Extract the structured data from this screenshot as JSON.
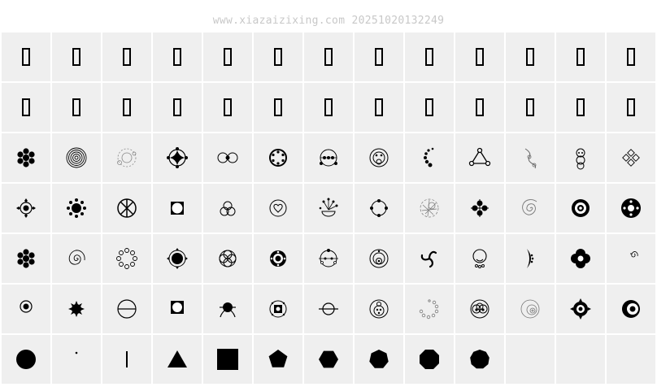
{
  "header": {
    "watermark": "www.xiazaizixing.com 20251020132249"
  },
  "glyph_grid": {
    "rows": 7,
    "columns": 13,
    "cells": [
      "notdef-icon",
      "notdef-icon",
      "notdef-icon",
      "notdef-icon",
      "notdef-icon",
      "notdef-icon",
      "notdef-icon",
      "notdef-icon",
      "notdef-icon",
      "notdef-icon",
      "notdef-icon",
      "notdef-icon",
      "notdef-icon",
      "notdef-icon",
      "notdef-icon",
      "notdef-icon",
      "notdef-icon",
      "notdef-icon",
      "notdef-icon",
      "notdef-icon",
      "notdef-icon",
      "notdef-icon",
      "notdef-icon",
      "notdef-icon",
      "notdef-icon",
      "notdef-icon",
      "flower-dots-icon",
      "concentric-rings-icon",
      "dotted-ring-icon",
      "diamond-star-icon",
      "linked-rings-icon",
      "ring-of-dots-icon",
      "orbit-dots-icon",
      "nested-circles-icon",
      "dot-arc-icon",
      "triangle-nodes-icon",
      "wave-curve-icon",
      "stacked-circles-icon",
      "diamond-cluster-icon",
      "target-diamond-icon",
      "spiky-sun-icon",
      "wheel-spokes-icon",
      "square-corners-icon",
      "trefoil-icon",
      "heart-ring-icon",
      "branch-dots-icon",
      "circle-dots-icon",
      "tangle-icon",
      "dot-cross-icon",
      "spiral-icon",
      "gear-circle-icon",
      "donut-dots-icon",
      "flower-dots-icon",
      "spiral-ring-icon",
      "scalloped-ring-icon",
      "ring-diamond-icon",
      "quad-petal-icon",
      "dot-ring-icon",
      "circle-line-dots-icon",
      "ornate-circle-icon",
      "triskele-icon",
      "pendant-circle-icon",
      "crescent-dots-icon",
      "quatrefoil-icon",
      "small-spiral-icon",
      "target-dot-icon",
      "small-sun-icon",
      "theta-circle-icon",
      "square-circle-icon",
      "bug-circle-icon",
      "boxed-circle-icon",
      "crossed-circle-icon",
      "face-circle-icon",
      "dotted-arc-icon",
      "triple-circles-icon",
      "spiral-circles-icon",
      "ornate-diamond-icon",
      "crescent-eye-icon",
      "disc-icon",
      "dot-icon",
      "vertical-bar-icon",
      "triangle-icon",
      "square-icon",
      "pentagon-icon",
      "hexagon-icon",
      "heptagon-icon",
      "octagon-icon",
      "nonagon-icon",
      "empty",
      "empty",
      "empty"
    ]
  }
}
